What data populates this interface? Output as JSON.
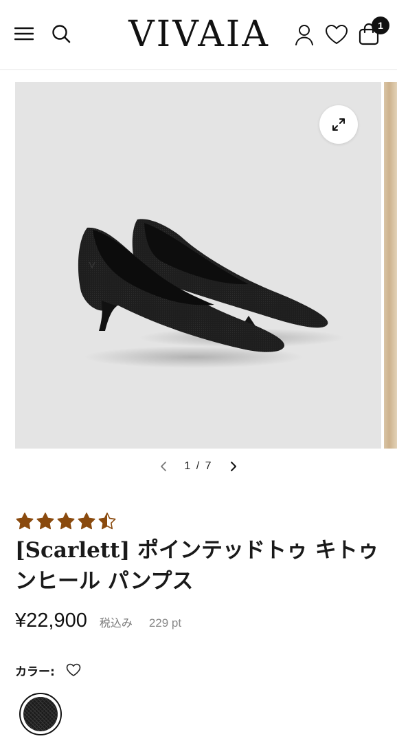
{
  "header": {
    "logo": "VIVAIA",
    "cart_count": "1",
    "icons": [
      "menu-icon",
      "search-icon",
      "account-icon",
      "wishlist-heart-icon",
      "cart-bag-icon"
    ]
  },
  "gallery": {
    "current": "1 / 7",
    "image_alt": "black knit pointed-toe kitten heel pumps",
    "icons": [
      "expand-icon",
      "chevron-left-icon",
      "chevron-right-icon"
    ]
  },
  "product": {
    "rating": 4.5,
    "rating_max": 5,
    "title": "[Scarlett] ポインテッドトゥ キトゥンヒール パンプス",
    "price": "¥22,900",
    "tax_note": "税込み",
    "points": "229 pt",
    "color_label": "カラー:",
    "star_color": "#8a4a0e",
    "swatches": [
      {
        "color": "#1c1c1c",
        "selected": true
      }
    ]
  }
}
